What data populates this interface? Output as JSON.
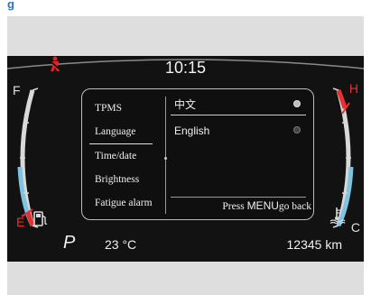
{
  "header": {
    "title_fragment": "g"
  },
  "status": {
    "time": "10:15"
  },
  "fuel_gauge": {
    "full_label": "F",
    "empty_label": "E",
    "icon": "fuel-pump-icon"
  },
  "temp_gauge": {
    "hot_label": "H",
    "cold_label": "C",
    "icon": "coolant-temperature-icon"
  },
  "warnings": {
    "seatbelt_icon": "seatbelt-warning-icon",
    "seatbelt_color": "#e02424"
  },
  "menu": {
    "items": [
      {
        "label": "TPMS"
      },
      {
        "label": "Language"
      },
      {
        "label": "Time/date"
      },
      {
        "label": "Brightness"
      },
      {
        "label": "Fatigue alarm"
      }
    ],
    "selected_item": "Language",
    "language_options": [
      {
        "label": "中文",
        "selected": true
      },
      {
        "label": "English",
        "selected": false
      }
    ],
    "hint_prefix": "Press ",
    "hint_key": "MENU",
    "hint_suffix": "go back"
  },
  "bottom_bar": {
    "gear": "P",
    "outside_temp": "23 °C",
    "odometer": "12345 km"
  },
  "colors": {
    "accent_blue": "#2a73c9",
    "warning_red": "#e83030",
    "gauge_blue": "#7ec3df",
    "display_bg": "#121212"
  }
}
